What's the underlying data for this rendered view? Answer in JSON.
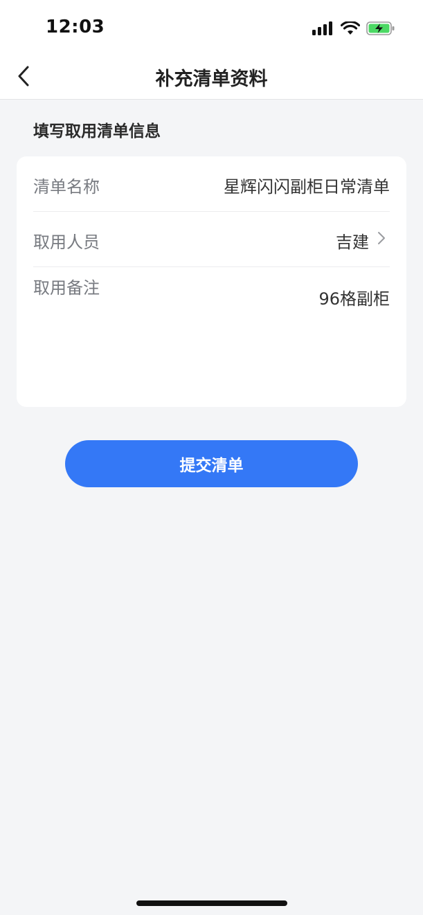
{
  "status_bar": {
    "time": "12:03",
    "icons": [
      "signal-icon",
      "wifi-icon",
      "battery-charging-icon"
    ]
  },
  "nav": {
    "back_icon": "chevron-left-icon",
    "title": "补充清单资料"
  },
  "form": {
    "section_title": "填写取用清单信息",
    "rows": [
      {
        "label": "清单名称",
        "value": "星辉闪闪副柜日常清单"
      },
      {
        "label": "取用人员",
        "value": "吉建",
        "icon": "chevron-right-icon"
      },
      {
        "label": "取用备注",
        "value": "96格副柜"
      }
    ]
  },
  "submit": {
    "label": "提交清单"
  },
  "colors": {
    "accent": "#3478f6",
    "background": "#f4f5f7",
    "card": "#ffffff",
    "battery": "#4cd964"
  }
}
